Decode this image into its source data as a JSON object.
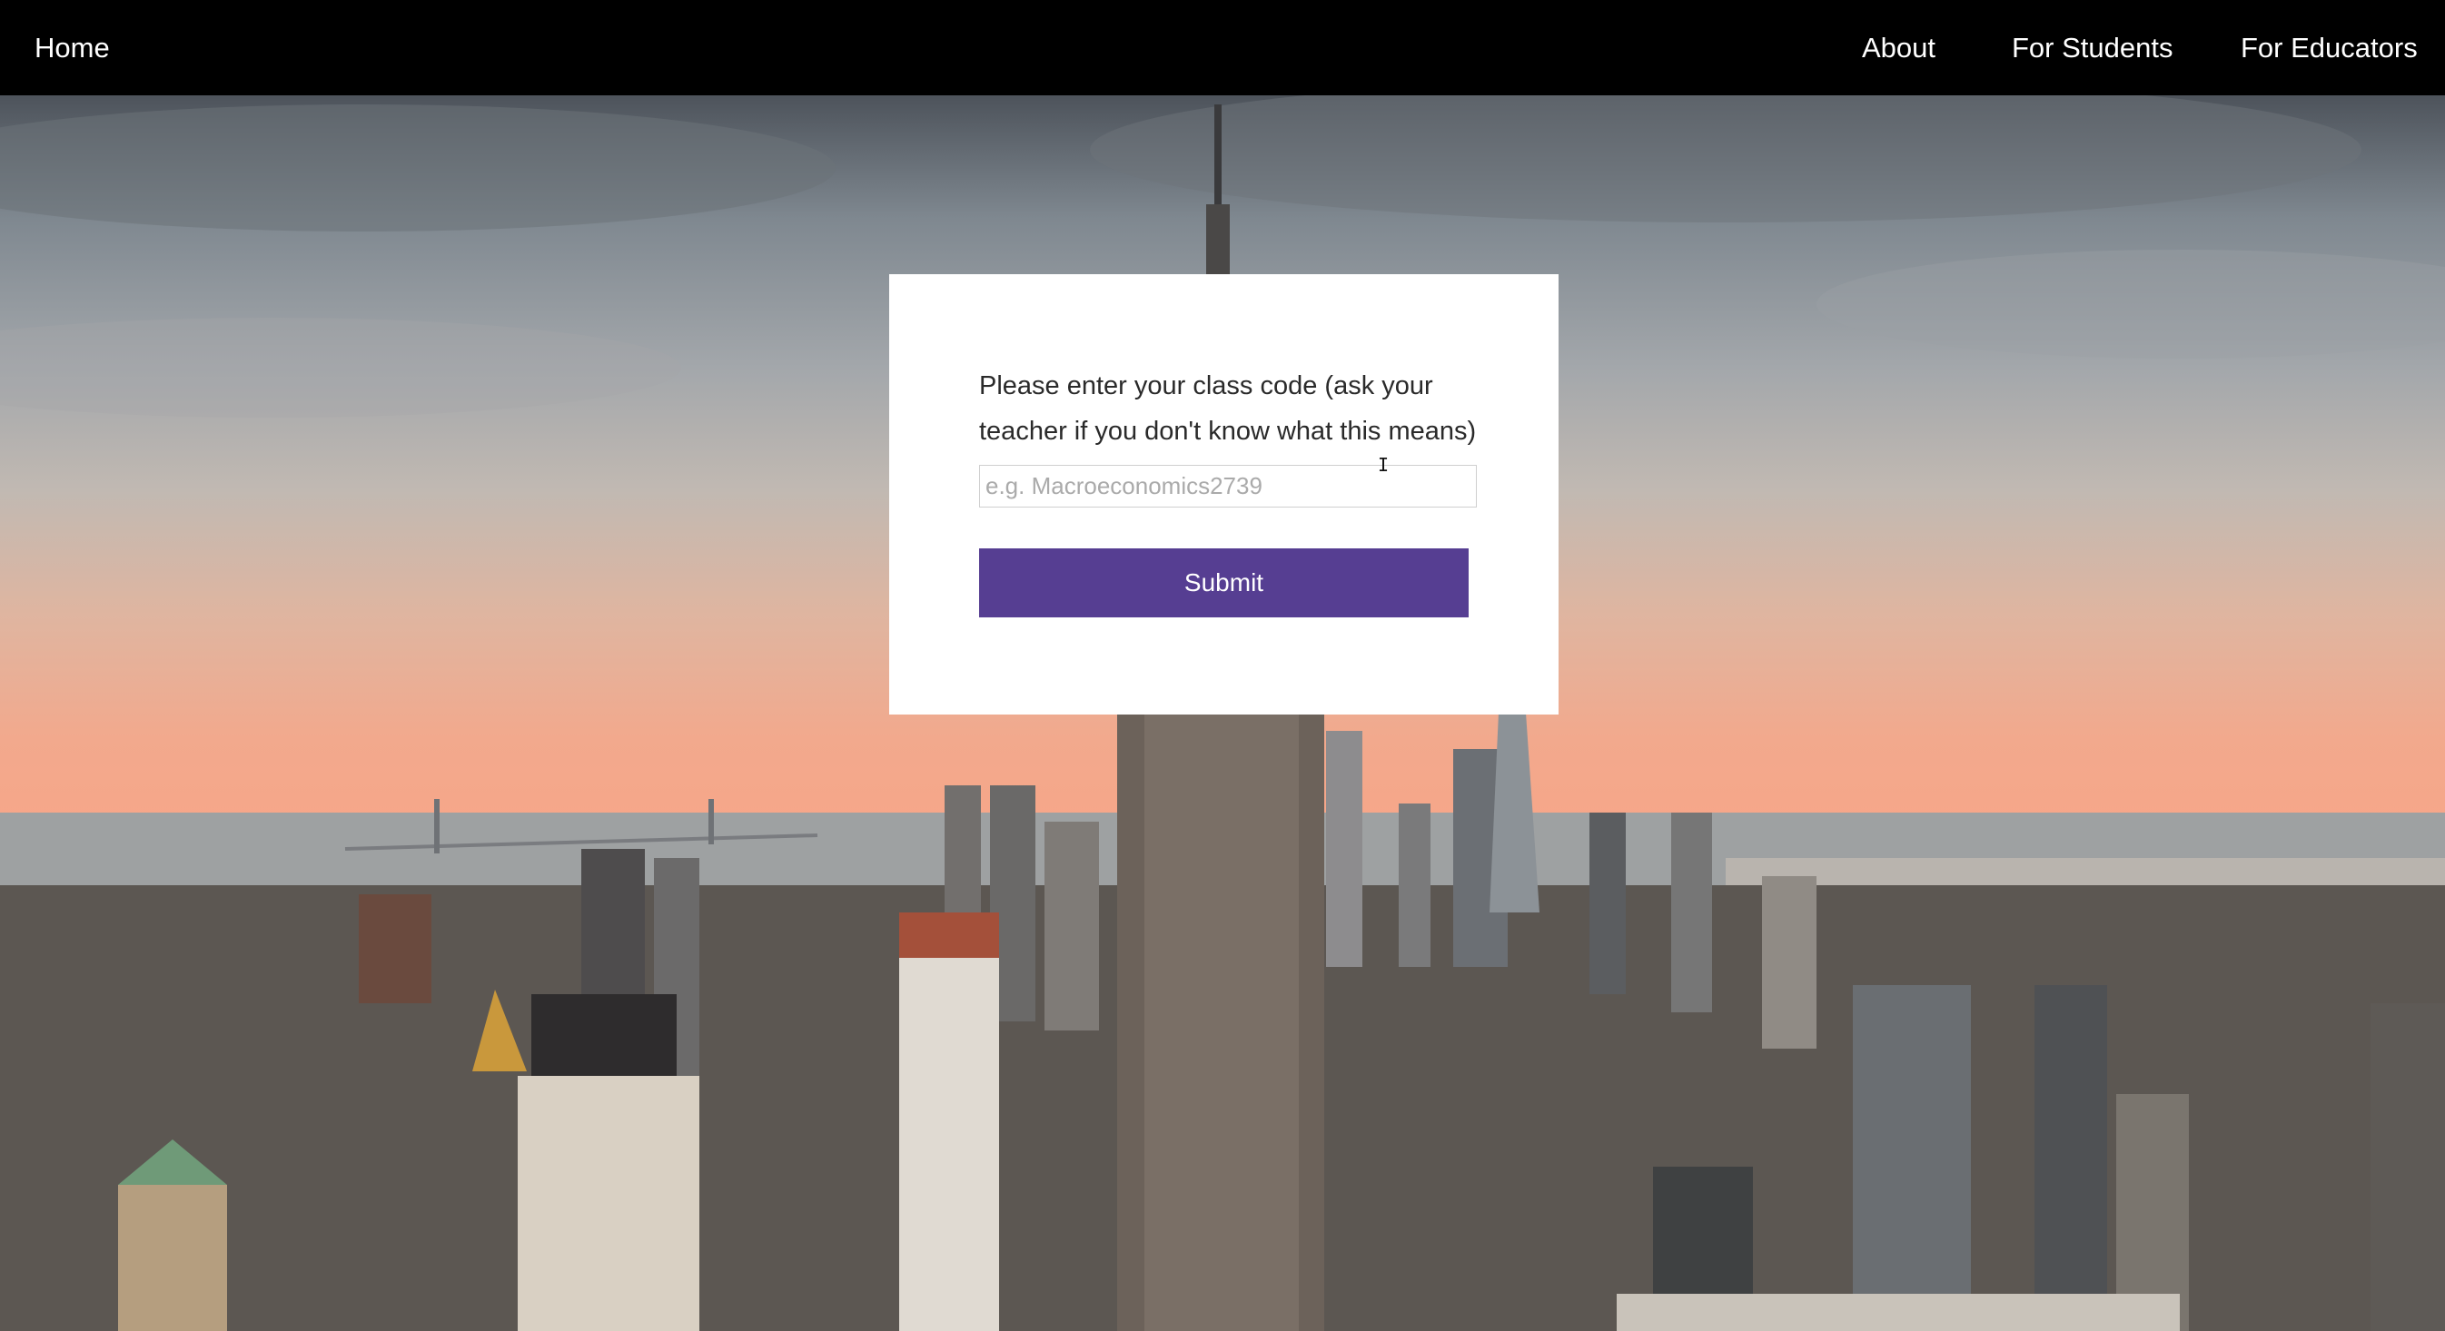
{
  "nav": {
    "home": "Home",
    "about": "About",
    "for_students": "For Students",
    "for_educators": "For Educators"
  },
  "modal": {
    "prompt": "Please enter your class code (ask your teacher if you don't know what this means)",
    "input_placeholder": "e.g. Macroeconomics2739",
    "input_value": "",
    "submit_label": "Submit"
  },
  "hero": {
    "image_description_icon": "city-skyline-background"
  },
  "colors": {
    "navbar_bg": "#000000",
    "submit_bg": "#563e92",
    "modal_bg": "#ffffff"
  }
}
